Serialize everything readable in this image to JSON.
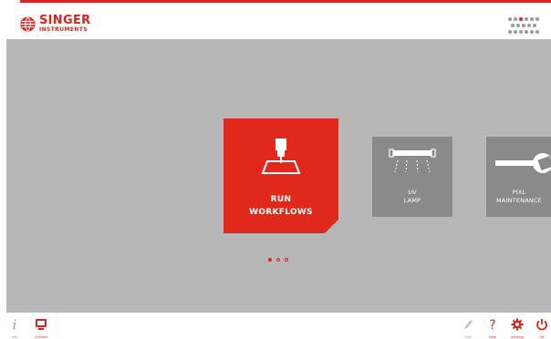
{
  "header": {
    "brand_name": "SINGER",
    "brand_sub": "INSTRUMENTS"
  },
  "tiles": [
    {
      "line1": "RUN",
      "line2": "WORKFLOWS",
      "icon": "pinning-robot-icon",
      "color": "#e0291b"
    },
    {
      "line1": "UV",
      "line2": "LAMP",
      "icon": "uv-lamp-icon",
      "color": "#8a8a8a"
    },
    {
      "line1": "PIXL",
      "line2": "MAINTENANCE",
      "icon": "wrench-icon",
      "color": "#8a8a8a"
    }
  ],
  "pager": {
    "count": 3,
    "active": 1
  },
  "footer": {
    "left": [
      {
        "label": "Info",
        "icon": "info-icon"
      },
      {
        "label": "Connect",
        "icon": "monitor-icon"
      }
    ],
    "right": [
      {
        "label": "Edit",
        "icon": "pencil-icon"
      },
      {
        "label": "Help",
        "icon": "question-icon"
      },
      {
        "label": "Settings",
        "icon": "gear-icon"
      },
      {
        "label": "Off",
        "icon": "power-icon"
      }
    ]
  },
  "colors": {
    "accent": "#d8241e",
    "tile_grey": "#8a8a8a",
    "background": "#b7b7b7"
  }
}
